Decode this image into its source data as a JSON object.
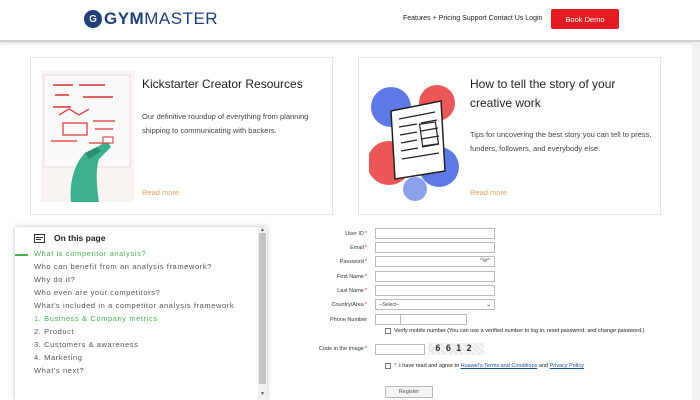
{
  "header": {
    "logo_mark": "G",
    "logo_gym": "GYM",
    "logo_master": "MASTER",
    "nav": [
      "Features",
      "+",
      "Pricing",
      "Support",
      "Contact Us",
      "Login"
    ],
    "book_demo": "Book Demo"
  },
  "cards": [
    {
      "title": "Kickstarter Creator Resources",
      "description": "Our definitive roundup of everything from planning shipping to communicating with backers.",
      "read_more": "Read more"
    },
    {
      "title": "How to tell the story of your creative work",
      "description": "Tips for uncovering the best story you can tell to press, funders, followers, and everybody else.",
      "read_more": "Read more"
    }
  ],
  "toc": {
    "heading": "On this page",
    "items": [
      "What is competitor analysis?",
      "Who can benefit from an analysis framework?",
      "Why do it?",
      "Who even are your competitors?",
      "What's included in a competitor analysis framework",
      "1. Business & Company metrics",
      "2. Product",
      "3. Customers & awareness",
      "4. Marketing",
      "What's next?"
    ],
    "active_index": 0
  },
  "form": {
    "user_id_label": "User ID",
    "email_label": "Email",
    "password_label": "Password",
    "password_suffix": "^w^",
    "first_name_label": "First Name",
    "last_name_label": "Last Name",
    "country_label": "Country/Area",
    "country_value": "--Select--",
    "phone_label": "Phone Number",
    "verify_text": "Verify mobile number (You can use a verified number to log in, reset password, and change password.)",
    "code_label": "Code in the Image",
    "captcha": "6612",
    "agree_prefix": "I have read and agree to",
    "agree_terms": "Huawei's Terms and Conditions",
    "agree_and": "and",
    "agree_privacy": "Privacy Policy",
    "register": "Register"
  },
  "colors": {
    "brand": "#1e3f78",
    "cta": "#e31b23",
    "toc_active": "#4caf50",
    "read_more": "#e0a05a"
  }
}
